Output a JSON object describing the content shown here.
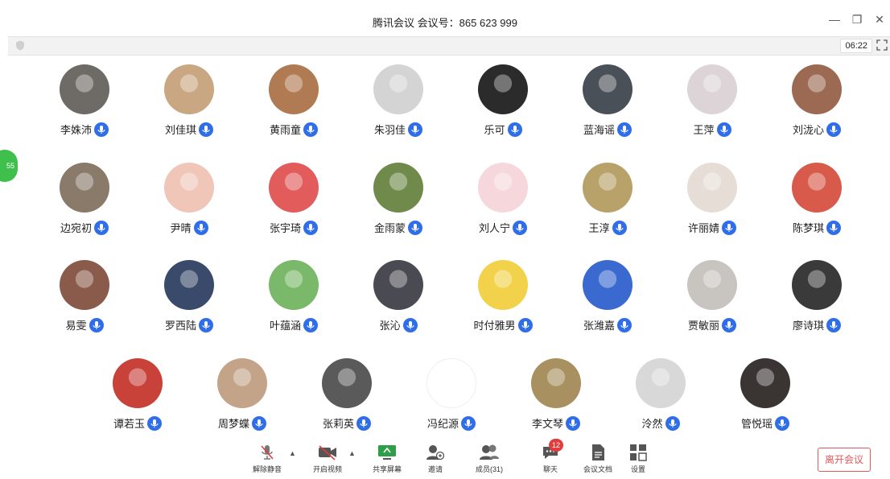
{
  "window": {
    "title": "腾讯会议 会议号：865 623 999",
    "minimize_label": "—",
    "restore_label": "❐",
    "close_label": "✕"
  },
  "toolbar": {
    "timer": "06:22"
  },
  "side_tab": {
    "label": "55"
  },
  "participants": [
    {
      "name": "李姝沛",
      "color": "#6e6a65",
      "mic": "on"
    },
    {
      "name": "刘佳琪",
      "color": "#c9a782",
      "mic": "on"
    },
    {
      "name": "黄雨童",
      "color": "#b07a52",
      "mic": "on"
    },
    {
      "name": "朱羽佳",
      "color": "#d4d4d4",
      "mic": "on"
    },
    {
      "name": "乐可",
      "color": "#2b2b2b",
      "mic": "on"
    },
    {
      "name": "蓝海谣",
      "color": "#4a5058",
      "mic": "on"
    },
    {
      "name": "王萍",
      "color": "#dcd4d6",
      "mic": "on"
    },
    {
      "name": "刘泷心",
      "color": "#9c6a52",
      "mic": "on"
    },
    {
      "name": "边宛初",
      "color": "#8a7a6a",
      "mic": "on"
    },
    {
      "name": "尹晴",
      "color": "#f0c6b8",
      "mic": "on"
    },
    {
      "name": "张宇琦",
      "color": "#e25c5c",
      "mic": "on"
    },
    {
      "name": "金雨蒙",
      "color": "#6f8a4a",
      "mic": "on"
    },
    {
      "name": "刘人宁",
      "color": "#f6d8dc",
      "mic": "on"
    },
    {
      "name": "王淳",
      "color": "#b8a26a",
      "mic": "on"
    },
    {
      "name": "许丽婧",
      "color": "#e6ddd6",
      "mic": "on"
    },
    {
      "name": "陈梦琪",
      "color": "#d85a4a",
      "mic": "on"
    },
    {
      "name": "易雯",
      "color": "#8a5a4a",
      "mic": "on"
    },
    {
      "name": "罗西陆",
      "color": "#3a4a6a",
      "mic": "on"
    },
    {
      "name": "叶蕴涵",
      "color": "#7ab86a",
      "mic": "on"
    },
    {
      "name": "张沁",
      "color": "#4a4a52",
      "mic": "on"
    },
    {
      "name": "时付雅男",
      "color": "#f2d24a",
      "mic": "on"
    },
    {
      "name": "张潍嘉",
      "color": "#3a6ad0",
      "mic": "on"
    },
    {
      "name": "贾敏丽",
      "color": "#c8c4c0",
      "mic": "on"
    },
    {
      "name": "廖诗琪",
      "color": "#3a3a3a",
      "mic": "on"
    },
    {
      "name": "谭若玉",
      "color": "#c8423a",
      "mic": "on"
    },
    {
      "name": "周梦蝶",
      "color": "#c4a488",
      "mic": "on"
    },
    {
      "name": "张莉英",
      "color": "#5a5a5a",
      "mic": "on"
    },
    {
      "name": "冯纪源",
      "color": "#ffffff",
      "mic": "on"
    },
    {
      "name": "李文琴",
      "color": "#a89060",
      "mic": "on"
    },
    {
      "name": "泠然",
      "color": "#d8d8d8",
      "mic": "on"
    },
    {
      "name": "管悦瑶",
      "color": "#3a3432",
      "mic": "on"
    }
  ],
  "controls": {
    "unmute": "解除静音",
    "video": "开启视频",
    "share": "共享屏幕",
    "invite": "邀请",
    "members": "成员(31)",
    "chat": "聊天",
    "chat_badge": "12",
    "docs": "会议文档",
    "settings": "设置",
    "leave": "离开会议"
  },
  "colors": {
    "accent_blue": "#2f6ee8",
    "leave_red": "#e05a5a",
    "badge_red": "#e23c3c",
    "side_tab_green": "#3fbf4b"
  }
}
